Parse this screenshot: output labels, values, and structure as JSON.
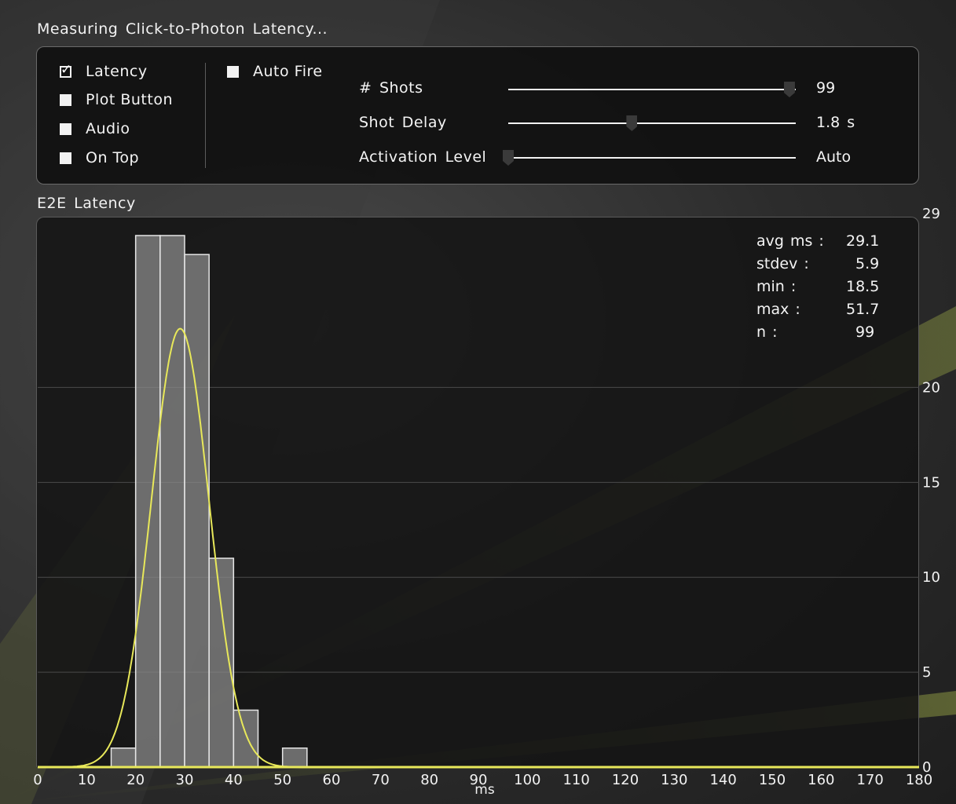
{
  "window": {
    "title": "Measuring Click-to-Photon Latency..."
  },
  "controls": {
    "checkboxes": [
      {
        "label": "Latency",
        "checked": true
      },
      {
        "label": "Plot Button",
        "checked": false
      },
      {
        "label": "Audio",
        "checked": false
      },
      {
        "label": "On Top",
        "checked": false
      }
    ],
    "auto_fire": {
      "label": "Auto Fire",
      "checked": false
    },
    "sliders": [
      {
        "label": "# Shots",
        "value_text": "99",
        "fraction": 0.978
      },
      {
        "label": "Shot Delay",
        "value_text": "1.8  s",
        "fraction": 0.43
      },
      {
        "label": "Activation Level",
        "value_text": "Auto",
        "fraction": 0.0
      }
    ]
  },
  "chart_title": "E2E Latency",
  "stats": [
    {
      "label": "avg  ms  :",
      "value": "29.1"
    },
    {
      "label": "stdev  :",
      "value": "5.9"
    },
    {
      "label": "min  :",
      "value": "18.5"
    },
    {
      "label": "max  :",
      "value": "51.7"
    },
    {
      "label": "n  :",
      "value": "99"
    }
  ],
  "colors": {
    "accent_curve": "#e8e85a",
    "bar_fill": "#8a8a8a",
    "bar_stroke": "#e6e6e6",
    "grid": "#4a4a4a"
  },
  "chart_data": {
    "type": "bar",
    "xlabel": "ms",
    "ylabel": "",
    "xlim": [
      0,
      180
    ],
    "ylim": [
      0,
      28
    ],
    "x_ticks": [
      0,
      10,
      20,
      30,
      40,
      50,
      60,
      70,
      80,
      90,
      100,
      110,
      120,
      130,
      140,
      150,
      160,
      170,
      180
    ],
    "y_ticks": [
      0,
      5,
      10,
      15,
      20,
      29
    ],
    "grid_lines": [
      5,
      10,
      15,
      20
    ],
    "bins": [
      {
        "x0": 15,
        "x1": 20,
        "count": 1
      },
      {
        "x0": 20,
        "x1": 25,
        "count": 28
      },
      {
        "x0": 25,
        "x1": 30,
        "count": 28
      },
      {
        "x0": 30,
        "x1": 35,
        "count": 27
      },
      {
        "x0": 35,
        "x1": 40,
        "count": 11
      },
      {
        "x0": 40,
        "x1": 45,
        "count": 3
      },
      {
        "x0": 50,
        "x1": 55,
        "count": 1
      }
    ],
    "fit_curve": {
      "type": "normal",
      "mean": 29.1,
      "stdev": 5.9,
      "peak": 23.1
    }
  }
}
